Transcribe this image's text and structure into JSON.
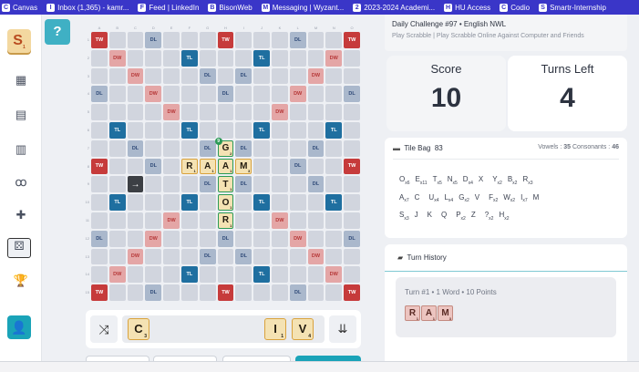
{
  "bookmarks": [
    {
      "label": "Canvas",
      "icon": "canvas-icon"
    },
    {
      "label": "Inbox (1,365) - kamr...",
      "icon": "gmail-icon"
    },
    {
      "label": "Feed | LinkedIn",
      "icon": "linkedin-icon"
    },
    {
      "label": "BisonWeb",
      "icon": "globe-icon"
    },
    {
      "label": "Messaging | Wyzant...",
      "icon": "wyzant-icon"
    },
    {
      "label": "2023-2024 Academi...",
      "icon": "globe-icon"
    },
    {
      "label": "HU Access",
      "icon": "hu-icon"
    },
    {
      "label": "Codio",
      "icon": "codio-icon"
    },
    {
      "label": "Smartr-Internship",
      "icon": "smartr-icon"
    }
  ],
  "logo": {
    "letter": "S",
    "sub": "1"
  },
  "help_label": "?",
  "board": {
    "columns": [
      "A",
      "B",
      "C",
      "D",
      "E",
      "F",
      "G",
      "H",
      "I",
      "J",
      "K",
      "L",
      "M",
      "N",
      "O"
    ],
    "rows": [
      "1",
      "2",
      "3",
      "4",
      "5",
      "6",
      "7",
      "8",
      "9",
      "10",
      "11",
      "12",
      "13",
      "14",
      "15"
    ],
    "premium_labels": {
      "TW": "TW",
      "DW": "DW",
      "TL": "TL",
      "DL": "DL"
    },
    "start_symbol": "→",
    "placed_tiles": [
      {
        "letter": "R",
        "points": "1",
        "row": 8,
        "col": 6
      },
      {
        "letter": "A",
        "points": "1",
        "row": 8,
        "col": 7
      },
      {
        "letter": "M",
        "points": "3",
        "row": 8,
        "col": 9
      },
      {
        "letter": "G",
        "points": "2",
        "row": 7,
        "col": 8,
        "badge": "9"
      },
      {
        "letter": "A",
        "points": "1",
        "row": 8,
        "col": 8
      },
      {
        "letter": "T",
        "points": "1",
        "row": 9,
        "col": 8
      },
      {
        "letter": "O",
        "points": "1",
        "row": 10,
        "col": 8
      },
      {
        "letter": "R",
        "points": "1",
        "row": 11,
        "col": 8
      }
    ]
  },
  "rack": {
    "tiles": [
      {
        "letter": "C",
        "points": "3"
      },
      {
        "letter": "I",
        "points": "1"
      },
      {
        "letter": "V",
        "points": "4"
      }
    ]
  },
  "challenge": {
    "title": "Daily Challenge #97 • English NWL",
    "subtitle": "Play Scrabble | Play Scrabble Online Against Computer and Friends"
  },
  "score": {
    "label": "Score",
    "value": "10"
  },
  "turns_left": {
    "label": "Turns Left",
    "value": "4"
  },
  "tile_bag": {
    "title": "Tile Bag",
    "count": "83",
    "vowels_label": "Vowels :",
    "vowels": "35",
    "consonants_label": "Consonants :",
    "consonants": "46",
    "lines": [
      [
        {
          "l": "O",
          "c": "x6"
        },
        {
          "l": "E",
          "c": "x11"
        },
        {
          "l": "T",
          "c": "x5"
        },
        {
          "l": "N",
          "c": "x5"
        },
        {
          "l": "D",
          "c": "x4"
        },
        {
          "l": "X",
          "c": ""
        },
        {
          "l": "Y",
          "c": "x2"
        },
        {
          "l": "B",
          "c": "x2"
        },
        {
          "l": "R",
          "c": "x3"
        }
      ],
      [
        {
          "l": "A",
          "c": "x7"
        },
        {
          "l": "C",
          "c": ""
        },
        {
          "l": "U",
          "c": "x4"
        },
        {
          "l": "L",
          "c": "x4"
        },
        {
          "l": "G",
          "c": "x2"
        },
        {
          "l": "V",
          "c": ""
        },
        {
          "l": "F",
          "c": "x2"
        },
        {
          "l": "W",
          "c": "x2"
        },
        {
          "l": "I",
          "c": "x7"
        },
        {
          "l": "M",
          "c": ""
        }
      ],
      [
        {
          "l": "S",
          "c": "x3"
        },
        {
          "l": "J",
          "c": ""
        },
        {
          "l": "K",
          "c": ""
        },
        {
          "l": "Q",
          "c": ""
        },
        {
          "l": "P",
          "c": "x2"
        },
        {
          "l": "Z",
          "c": ""
        },
        {
          "l": "?",
          "c": "x2"
        },
        {
          "l": "H",
          "c": "x2"
        }
      ]
    ]
  },
  "history": {
    "title": "Turn History",
    "turn_text": "Turn #1 • 1 Word • 10 Points",
    "word_tiles": [
      {
        "letter": "R",
        "points": "1"
      },
      {
        "letter": "A",
        "points": "1"
      },
      {
        "letter": "M",
        "points": "3"
      }
    ]
  }
}
